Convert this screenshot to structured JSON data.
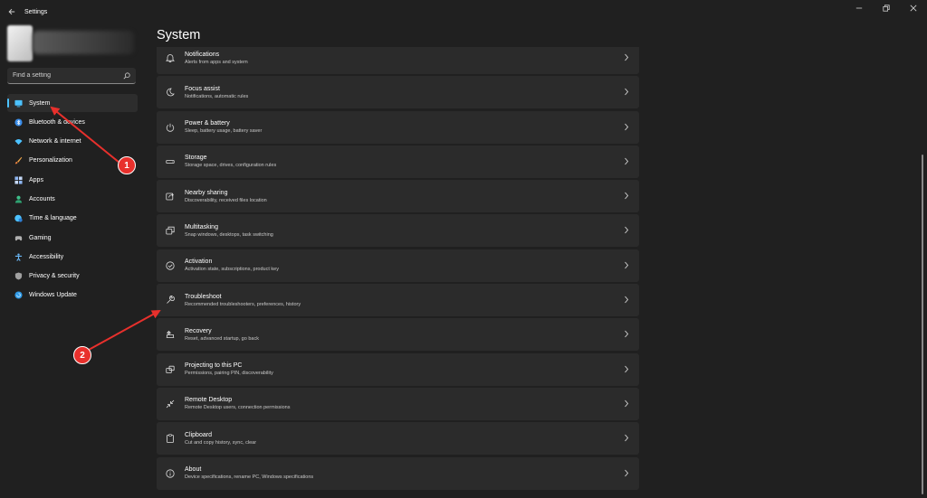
{
  "window": {
    "title": "Settings",
    "controls": [
      "minimize-icon",
      "restore-icon",
      "close-icon"
    ]
  },
  "sidebar": {
    "search_placeholder": "Find a setting",
    "items": [
      {
        "label": "System",
        "icon": "monitor-icon",
        "color": "#4cc2ff",
        "active": true
      },
      {
        "label": "Bluetooth & devices",
        "icon": "bluetooth-icon",
        "color": "#3b8eea"
      },
      {
        "label": "Network & internet",
        "icon": "wifi-icon",
        "color": "#4cc2ff"
      },
      {
        "label": "Personalization",
        "icon": "brush-icon",
        "color": "#f0a64a"
      },
      {
        "label": "Apps",
        "icon": "apps-icon",
        "color": "#8fb7f2"
      },
      {
        "label": "Accounts",
        "icon": "person-icon",
        "color": "#3ec08a"
      },
      {
        "label": "Time & language",
        "icon": "globe-clock-icon",
        "color": "#4cc2ff"
      },
      {
        "label": "Gaming",
        "icon": "gamepad-icon",
        "color": "#b0b0b0"
      },
      {
        "label": "Accessibility",
        "icon": "accessibility-icon",
        "color": "#6ab7f5"
      },
      {
        "label": "Privacy & security",
        "icon": "shield-icon",
        "color": "#a0a0a0"
      },
      {
        "label": "Windows Update",
        "icon": "update-icon",
        "color": "#2f9be8"
      }
    ]
  },
  "main": {
    "title": "System",
    "settings": [
      {
        "title": "Notifications",
        "subtitle": "Alerts from apps and system",
        "icon": "bell-icon"
      },
      {
        "title": "Focus assist",
        "subtitle": "Notifications, automatic rules",
        "icon": "moon-icon"
      },
      {
        "title": "Power & battery",
        "subtitle": "Sleep, battery usage, battery saver",
        "icon": "power-icon"
      },
      {
        "title": "Storage",
        "subtitle": "Storage space, drives, configuration rules",
        "icon": "storage-icon"
      },
      {
        "title": "Nearby sharing",
        "subtitle": "Discoverability, received files location",
        "icon": "share-icon"
      },
      {
        "title": "Multitasking",
        "subtitle": "Snap windows, desktops, task switching",
        "icon": "multitask-icon"
      },
      {
        "title": "Activation",
        "subtitle": "Activation state, subscriptions, product key",
        "icon": "check-circle-icon"
      },
      {
        "title": "Troubleshoot",
        "subtitle": "Recommended troubleshooters, preferences, history",
        "icon": "wrench-icon"
      },
      {
        "title": "Recovery",
        "subtitle": "Reset, advanced startup, go back",
        "icon": "recovery-icon"
      },
      {
        "title": "Projecting to this PC",
        "subtitle": "Permissions, pairing PIN, discoverability",
        "icon": "project-icon"
      },
      {
        "title": "Remote Desktop",
        "subtitle": "Remote Desktop users, connection permissions",
        "icon": "remote-desktop-icon"
      },
      {
        "title": "Clipboard",
        "subtitle": "Cut and copy history, sync, clear",
        "icon": "clipboard-icon"
      },
      {
        "title": "About",
        "subtitle": "Device specifications, rename PC, Windows specifications",
        "icon": "info-icon"
      }
    ]
  },
  "annotations": [
    {
      "number": "1",
      "points_to": "System"
    },
    {
      "number": "2",
      "points_to": "Troubleshoot"
    }
  ],
  "colors": {
    "accent": "#4cc2ff",
    "marker": "#e8302c",
    "background": "#202020",
    "card": "#2b2b2b"
  }
}
